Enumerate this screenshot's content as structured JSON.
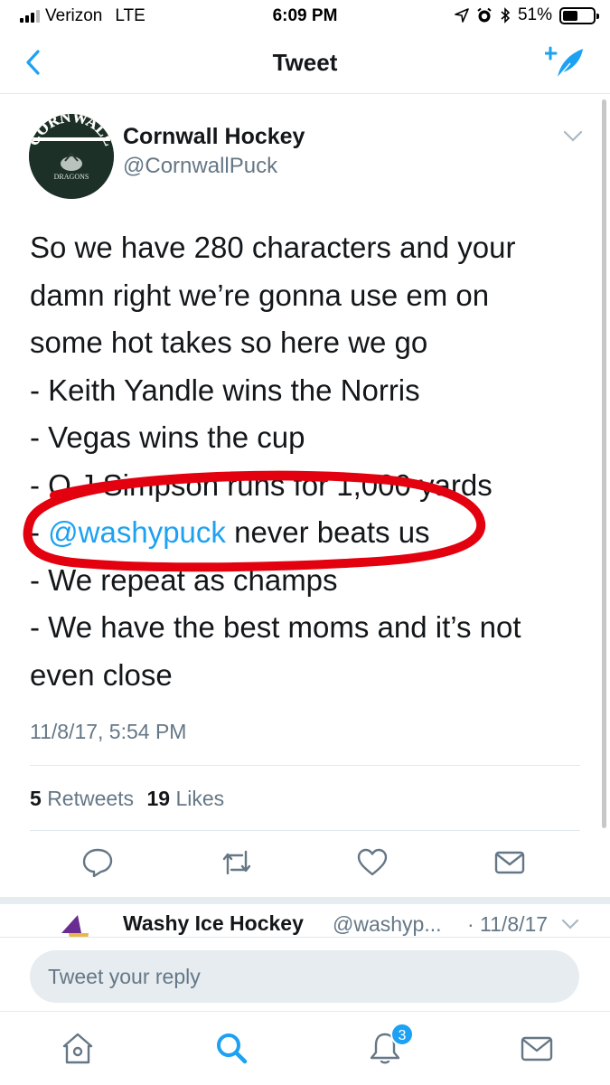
{
  "status_bar": {
    "carrier": "Verizon",
    "network": "LTE",
    "time": "6:09 PM",
    "battery": "51%",
    "battery_level": 0.51,
    "icons": [
      "signal-bars-icon",
      "location-arrow-icon",
      "alarm-clock-icon",
      "bluetooth-icon",
      "battery-icon"
    ]
  },
  "nav": {
    "title": "Tweet",
    "back_icon": "chevron-left-icon",
    "compose_icon": "compose-tweet-icon"
  },
  "tweet": {
    "author_name": "Cornwall Hockey",
    "author_handle": "@CornwallPuck",
    "avatar_text": "CORNWALL",
    "avatar_subtext": "DRAGONS",
    "body_lines": [
      "So we have 280 characters and your",
      "damn right we’re gonna use em on",
      "some hot takes so here we go",
      "- Keith Yandle wins the Norris",
      "- Vegas wins the cup",
      "- O.J Simpson runs for 1,000 yards",
      "- ",
      "- We repeat as champs",
      "- We have the best moms and it’s not",
      "even close"
    ],
    "mention_line": {
      "mention": "@washypuck",
      "rest": " never beats us"
    },
    "timestamp": "11/8/17, 5:54 PM",
    "retweets_count": "5",
    "retweets_label": "Retweets",
    "likes_count": "19",
    "likes_label": "Likes",
    "annotation_color": "#e3000f",
    "actions": [
      "reply-icon",
      "retweet-icon",
      "like-heart-icon",
      "direct-message-icon"
    ]
  },
  "reply_preview": {
    "name": "Washy Ice Hockey",
    "handle": "@washyp...",
    "time": "· 11/8/17"
  },
  "reply_input": {
    "placeholder": "Tweet your reply"
  },
  "tab_bar": {
    "tabs": [
      "home-icon",
      "search-icon",
      "notifications-bell-icon",
      "messages-icon"
    ],
    "notifications_badge": "3",
    "active_tab": "search-icon"
  },
  "colors": {
    "accent": "#1da1f2",
    "secondary_text": "#657786",
    "divider": "#e1e8ed"
  }
}
